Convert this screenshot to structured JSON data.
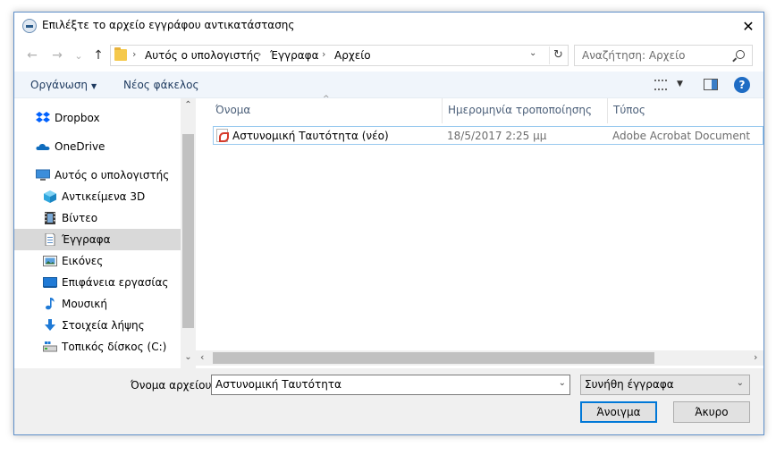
{
  "window": {
    "title": "Επιλέξτε το αρχείο εγγράφου αντικατάστασης",
    "close_glyph": "✕"
  },
  "nav": {
    "back_glyph": "←",
    "forward_glyph": "→",
    "recent_glyph": "⌄",
    "up_glyph": "↑"
  },
  "address": {
    "crumbs": [
      "Αυτός ο υπολογιστής",
      "Έγγραφα",
      "Αρχείο"
    ],
    "sep": "›",
    "dropdown_glyph": "⌄",
    "refresh_glyph": "↻"
  },
  "search": {
    "placeholder": "Αναζήτηση: Αρχείο"
  },
  "toolbar": {
    "organize_label": "Οργάνωση",
    "organize_caret": "▼",
    "new_folder_label": "Νέος φάκελος",
    "view_caret": "▼",
    "help_glyph": "?"
  },
  "sidebar": {
    "items": [
      {
        "label": "Dropbox",
        "icon": "dropbox-icon"
      },
      {
        "label": "OneDrive",
        "icon": "onedrive-icon"
      },
      {
        "label": "Αυτός ο υπολογιστής",
        "icon": "computer-icon"
      },
      {
        "label": "Αντικείμενα 3D",
        "icon": "objects-3d-icon"
      },
      {
        "label": "Βίντεο",
        "icon": "video-icon"
      },
      {
        "label": "Έγγραφα",
        "icon": "documents-icon",
        "selected": true
      },
      {
        "label": "Εικόνες",
        "icon": "pictures-icon"
      },
      {
        "label": "Επιφάνεια εργασίας",
        "icon": "desktop-icon"
      },
      {
        "label": "Μουσική",
        "icon": "music-icon"
      },
      {
        "label": "Στοιχεία λήψης",
        "icon": "downloads-icon"
      },
      {
        "label": "Τοπικός δίσκος (C:)",
        "icon": "local-disk-icon"
      }
    ],
    "scroll_up": "⌃",
    "scroll_down": "⌄"
  },
  "file_list": {
    "columns": [
      "Όνομα",
      "Ημερομηνία τροποποίησης",
      "Τύπος"
    ],
    "sort_glyph": "^",
    "rows": [
      {
        "name": "Αστυνομική Ταυτότητα (νέο)",
        "modified": "18/5/2017 2:25 μμ",
        "type": "Adobe Acrobat Document"
      }
    ],
    "hscroll_left": "‹",
    "hscroll_right": "›"
  },
  "footer": {
    "filename_label": "Όνομα αρχείου:",
    "filename_value": "Αστυνομική Ταυτότητα",
    "filename_dropdown": "⌄",
    "filetype_value": "Συνήθη έγγραφα",
    "filetype_dropdown": "⌄",
    "open_label": "Άνοιγμα",
    "cancel_label": "Άκυρο"
  },
  "colors": {
    "accent": "#0078d7",
    "selection": "#d9d9d9",
    "toolbar_bg": "#f0f5fb"
  }
}
